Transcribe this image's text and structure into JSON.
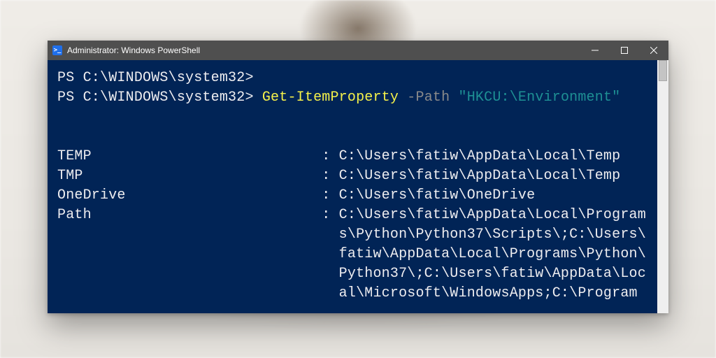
{
  "window": {
    "title": "Administrator: Windows PowerShell"
  },
  "terminal": {
    "line1_prompt": "PS C:\\WINDOWS\\system32>",
    "line2_prompt": "PS C:\\WINDOWS\\system32> ",
    "cmd_cmdlet": "Get-ItemProperty",
    "cmd_space1": " ",
    "cmd_param": "-Path",
    "cmd_space2": " ",
    "cmd_string": "\"HKCU:\\Environment\"",
    "blank1": "",
    "blank2": "",
    "out1": "TEMP                           : C:\\Users\\fatiw\\AppData\\Local\\Temp",
    "out2": "TMP                            : C:\\Users\\fatiw\\AppData\\Local\\Temp",
    "out3": "OneDrive                       : C:\\Users\\fatiw\\OneDrive",
    "out4": "Path                           : C:\\Users\\fatiw\\AppData\\Local\\Program",
    "out5": "                                 s\\Python\\Python37\\Scripts\\;C:\\Users\\",
    "out6": "                                 fatiw\\AppData\\Local\\Programs\\Python\\",
    "out7": "                                 Python37\\;C:\\Users\\fatiw\\AppData\\Loc",
    "out8": "                                 al\\Microsoft\\WindowsApps;C:\\Program"
  },
  "icons": {
    "app": ">_"
  }
}
